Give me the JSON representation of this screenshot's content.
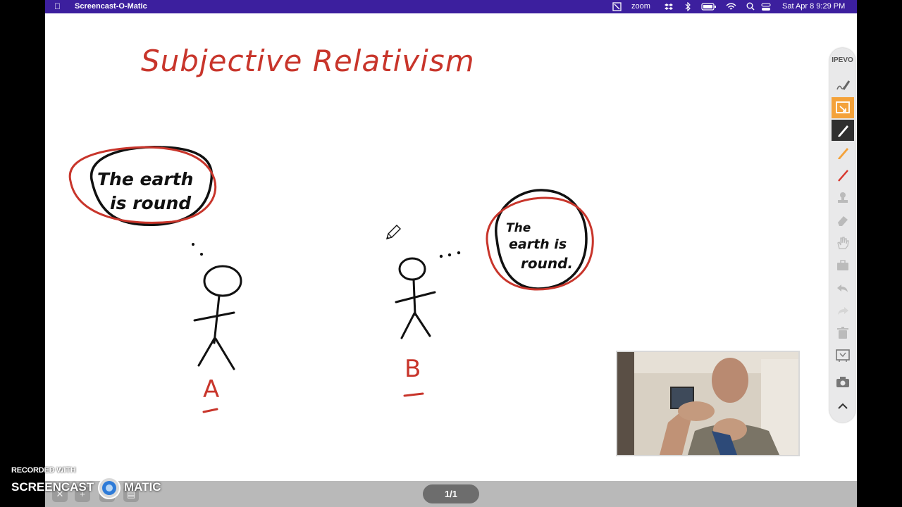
{
  "menubar": {
    "app_name": "Screencast-O-Matic",
    "zoom_label": "zoom",
    "clock": "Sat Apr 8  9:29 PM"
  },
  "whiteboard": {
    "title": "Subjective Relativism",
    "bubble_a": [
      "The earth",
      "is round"
    ],
    "bubble_b": [
      "The",
      "earth is",
      "round."
    ],
    "label_a": "A",
    "label_b": "B",
    "ink_colors": {
      "black": "#111111",
      "red": "#c8352b"
    }
  },
  "toolbar": {
    "brand": "IPEVO",
    "tools": [
      "pen-draw-icon",
      "annotation-mode-icon",
      "pen-icon",
      "highlighter-icon",
      "red-pen-icon",
      "stamp-icon",
      "eraser-icon",
      "hand-icon",
      "toolbox-icon",
      "undo-icon",
      "redo-icon",
      "trash-icon",
      "whiteboard-icon",
      "camera-icon",
      "collapse-icon"
    ],
    "active_color": "#f4a23a"
  },
  "bottom_bar": {
    "page_indicator": "1/1",
    "buttons": [
      "close-icon",
      "new-page-icon",
      "copy-icon",
      "save-icon"
    ]
  },
  "watermark": {
    "line1": "RECORDED WITH",
    "left": "SCREENCAST",
    "right": "MATIC"
  }
}
